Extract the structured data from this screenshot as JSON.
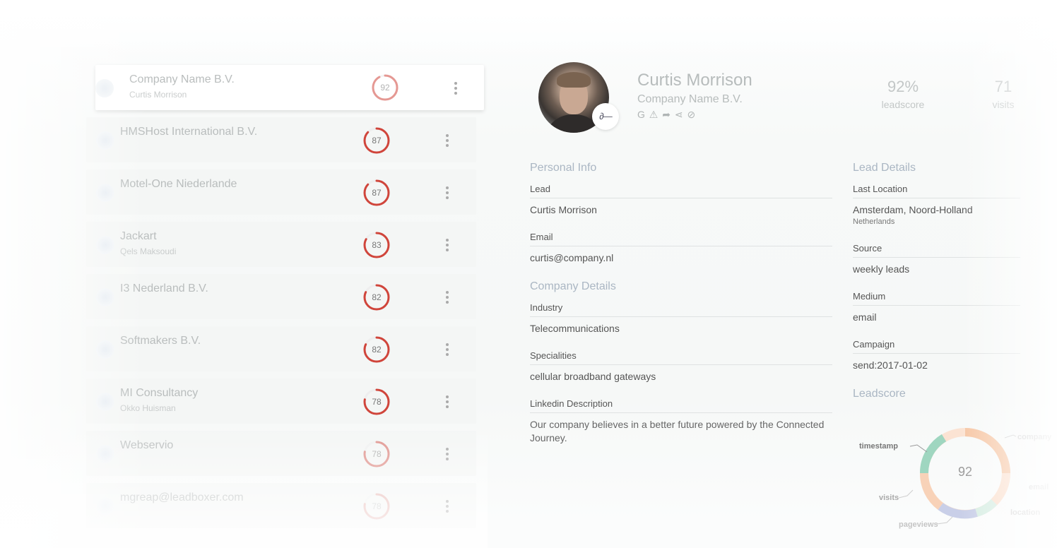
{
  "colors": {
    "ring_red": "#d0453b",
    "ring_track": "#eeeeee",
    "section_blue": "#aab6c3",
    "donut_orange": "#f6c7a6",
    "donut_green": "#9fd6c0",
    "donut_lavender": "#c9cfe8",
    "donut_track": "#fbe3d3"
  },
  "leads": [
    {
      "company": "Company Name B.V.",
      "contact": "Curtis Morrison",
      "score": "92",
      "score_value": 92,
      "icon": "globe-icon",
      "active": true
    },
    {
      "company": "HMSHost International B.V.",
      "contact": "",
      "score": "87",
      "score_value": 87,
      "icon": "location-icon",
      "active": false
    },
    {
      "company": "Motel-One Niederlande",
      "contact": "",
      "score": "87",
      "score_value": 87,
      "icon": "company-logo-icon",
      "active": false
    },
    {
      "company": "Jackart",
      "contact": "Qels Maksoudi",
      "score": "83",
      "score_value": 83,
      "icon": "company-logo-icon",
      "active": false
    },
    {
      "company": "I3 Nederland B.V.",
      "contact": "",
      "score": "82",
      "score_value": 82,
      "icon": "shield-icon",
      "active": false
    },
    {
      "company": "Softmakers B.V.",
      "contact": "",
      "score": "82",
      "score_value": 82,
      "icon": "card-icon",
      "active": false
    },
    {
      "company": "MI Consultancy",
      "contact": "Okko Huisman",
      "score": "78",
      "score_value": 78,
      "icon": "company-logo-icon",
      "active": false
    },
    {
      "company": "Webservio",
      "contact": "",
      "score": "78",
      "score_value": 78,
      "icon": "link-icon",
      "active": false
    },
    {
      "company": "mgreap@leadboxer.com",
      "contact": "",
      "score": "78",
      "score_value": 78,
      "icon": "mail-icon",
      "active": false
    }
  ],
  "profile": {
    "name": "Curtis Morrison",
    "company": "Company Name B.V.",
    "action_icons": "G ⚠ ➦ ⋖ ⊘",
    "badge_icon": "leadboxer-logo-icon",
    "badge_text": "∂—"
  },
  "stats": [
    {
      "value": "92%",
      "label": "leadscore"
    },
    {
      "value": "71",
      "label": "visits"
    }
  ],
  "personal_info": {
    "title": "Personal Info",
    "lead_label": "Lead",
    "lead_value": "Curtis Morrison",
    "email_label": "Email",
    "email_value": "curtis@company.nl"
  },
  "company_details": {
    "title": "Company Details",
    "industry_label": "Industry",
    "industry_value": "Telecommunications",
    "specialities_label": "Specialities",
    "specialities_value": "cellular broadband gateways",
    "linkedin_label": "Linkedin Description",
    "linkedin_value": "Our company believes in a better future powered by the Connected Journey."
  },
  "lead_details": {
    "title": "Lead Details",
    "location_label": "Last Location",
    "location_value": "Amsterdam, Noord-Holland",
    "location_country": "Netherlands",
    "source_label": "Source",
    "source_value": "weekly leads",
    "medium_label": "Medium",
    "medium_value": "email",
    "campaign_label": "Campaign",
    "campaign_value": "send:2017-01-02"
  },
  "leadscore_chart": {
    "title": "Leadscore",
    "center_value": "92",
    "labels": {
      "timestamp": "timestamp",
      "company": "company",
      "email": "email",
      "location": "location",
      "visits": "visits",
      "pageviews": "pageviews"
    }
  }
}
